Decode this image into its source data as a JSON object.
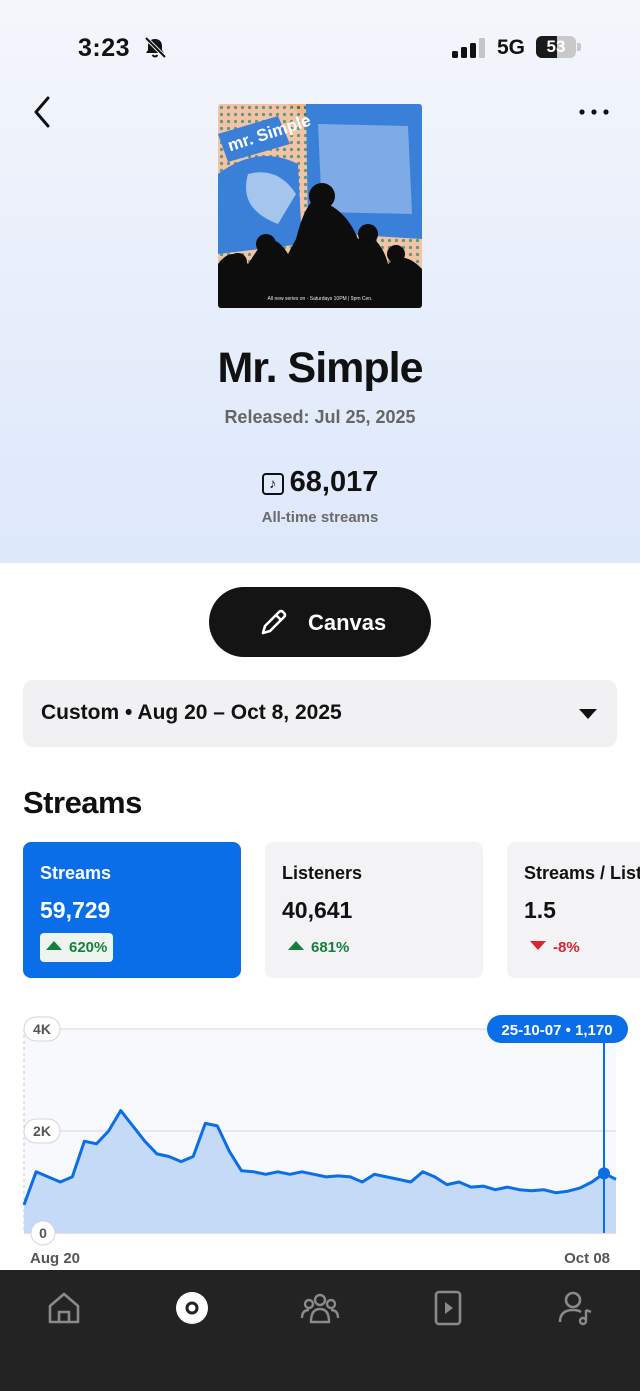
{
  "status_bar": {
    "time": "3:23",
    "network": "5G",
    "battery_level": "53",
    "battery_fraction": 0.53,
    "icons": [
      "bell-muted-icon",
      "cellular-signal-icon",
      "battery-icon"
    ]
  },
  "header": {
    "icons": [
      "back-chevron-icon",
      "more-dots-icon"
    ]
  },
  "track": {
    "title": "Mr. Simple",
    "released": "Released: Jul 25, 2025",
    "all_time_streams": "68,017",
    "all_time_label": "All-time streams",
    "cover_art": {
      "title_text": "mr. Simple",
      "footer_text": "All new series on · Saturdays 10PM | 9pm Cen."
    }
  },
  "canvas_button": {
    "label": "Canvas",
    "icon": "pencil-icon"
  },
  "date_range": {
    "label": "Custom • Aug 20 – Oct 8, 2025",
    "icon": "caret-down-icon"
  },
  "streams_section": {
    "title": "Streams",
    "metrics": [
      {
        "name": "Streams",
        "value": "59,729",
        "change": "620%",
        "direction": "up",
        "active": true
      },
      {
        "name": "Listeners",
        "value": "40,641",
        "change": "681%",
        "direction": "up",
        "active": false
      },
      {
        "name": "Streams / Listener",
        "value": "1.5",
        "change": "-8%",
        "direction": "down",
        "active": false
      }
    ]
  },
  "chart_data": {
    "type": "area",
    "x_labels": [
      "Aug 20",
      "Oct 08"
    ],
    "y_ticks": [
      "4K",
      "2K",
      "0"
    ],
    "ylim": [
      0,
      4000
    ],
    "grid": true,
    "tooltip": "25-10-07 • 1,170",
    "highlight_index": 48,
    "values": [
      550,
      1200,
      1100,
      1000,
      1100,
      1800,
      1750,
      2000,
      2400,
      2100,
      1800,
      1550,
      1500,
      1400,
      1500,
      2150,
      2100,
      1600,
      1220,
      1200,
      1150,
      1200,
      1150,
      1200,
      1150,
      1100,
      1120,
      1100,
      1000,
      1150,
      1100,
      1050,
      1000,
      1200,
      1100,
      950,
      1000,
      900,
      920,
      850,
      900,
      850,
      830,
      850,
      790,
      820,
      880,
      1000,
      1170
    ],
    "color": "#0a6ee8",
    "fill": "#c4daf7"
  },
  "tab_bar": {
    "icons": [
      "home-icon",
      "music-disc-icon",
      "audience-icon",
      "video-play-icon",
      "artist-profile-icon"
    ],
    "active_index": 1
  }
}
